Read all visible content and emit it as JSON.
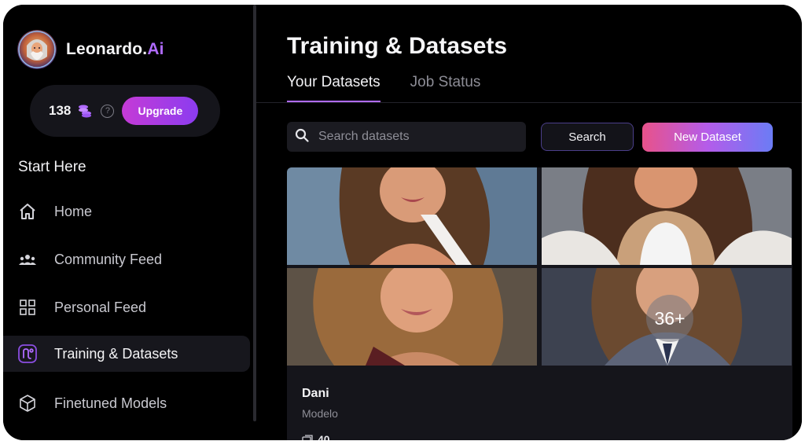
{
  "brand": {
    "name_main": "Leonardo.",
    "name_accent": "Ai"
  },
  "credits": {
    "count": "138",
    "upgrade_label": "Upgrade",
    "help_symbol": "?"
  },
  "sidebar": {
    "section_title": "Start Here",
    "items": [
      {
        "label": "Home",
        "icon": "home-icon",
        "active": false
      },
      {
        "label": "Community Feed",
        "icon": "community-icon",
        "active": false
      },
      {
        "label": "Personal Feed",
        "icon": "grid-icon",
        "active": false
      },
      {
        "label": "Training & Datasets",
        "icon": "training-icon",
        "active": true
      },
      {
        "label": "Finetuned Models",
        "icon": "cube-icon",
        "active": false
      }
    ]
  },
  "main": {
    "title": "Training & Datasets",
    "tabs": [
      {
        "label": "Your Datasets",
        "active": true
      },
      {
        "label": "Job Status",
        "active": false
      }
    ],
    "search": {
      "placeholder": "Search datasets",
      "button_label": "Search"
    },
    "new_dataset_label": "New Dataset"
  },
  "dataset": {
    "name": "Dani",
    "description": "Modelo",
    "more_count": "36+",
    "image_count": "40"
  },
  "colors": {
    "accent": "#b06bff",
    "upgrade_gradient": [
      "#c53bd6",
      "#8b3cf0"
    ],
    "new_dataset_gradient": [
      "#e8528a",
      "#b45cea",
      "#6b7cf5"
    ],
    "background": "#000000",
    "panel": "#15151b"
  }
}
